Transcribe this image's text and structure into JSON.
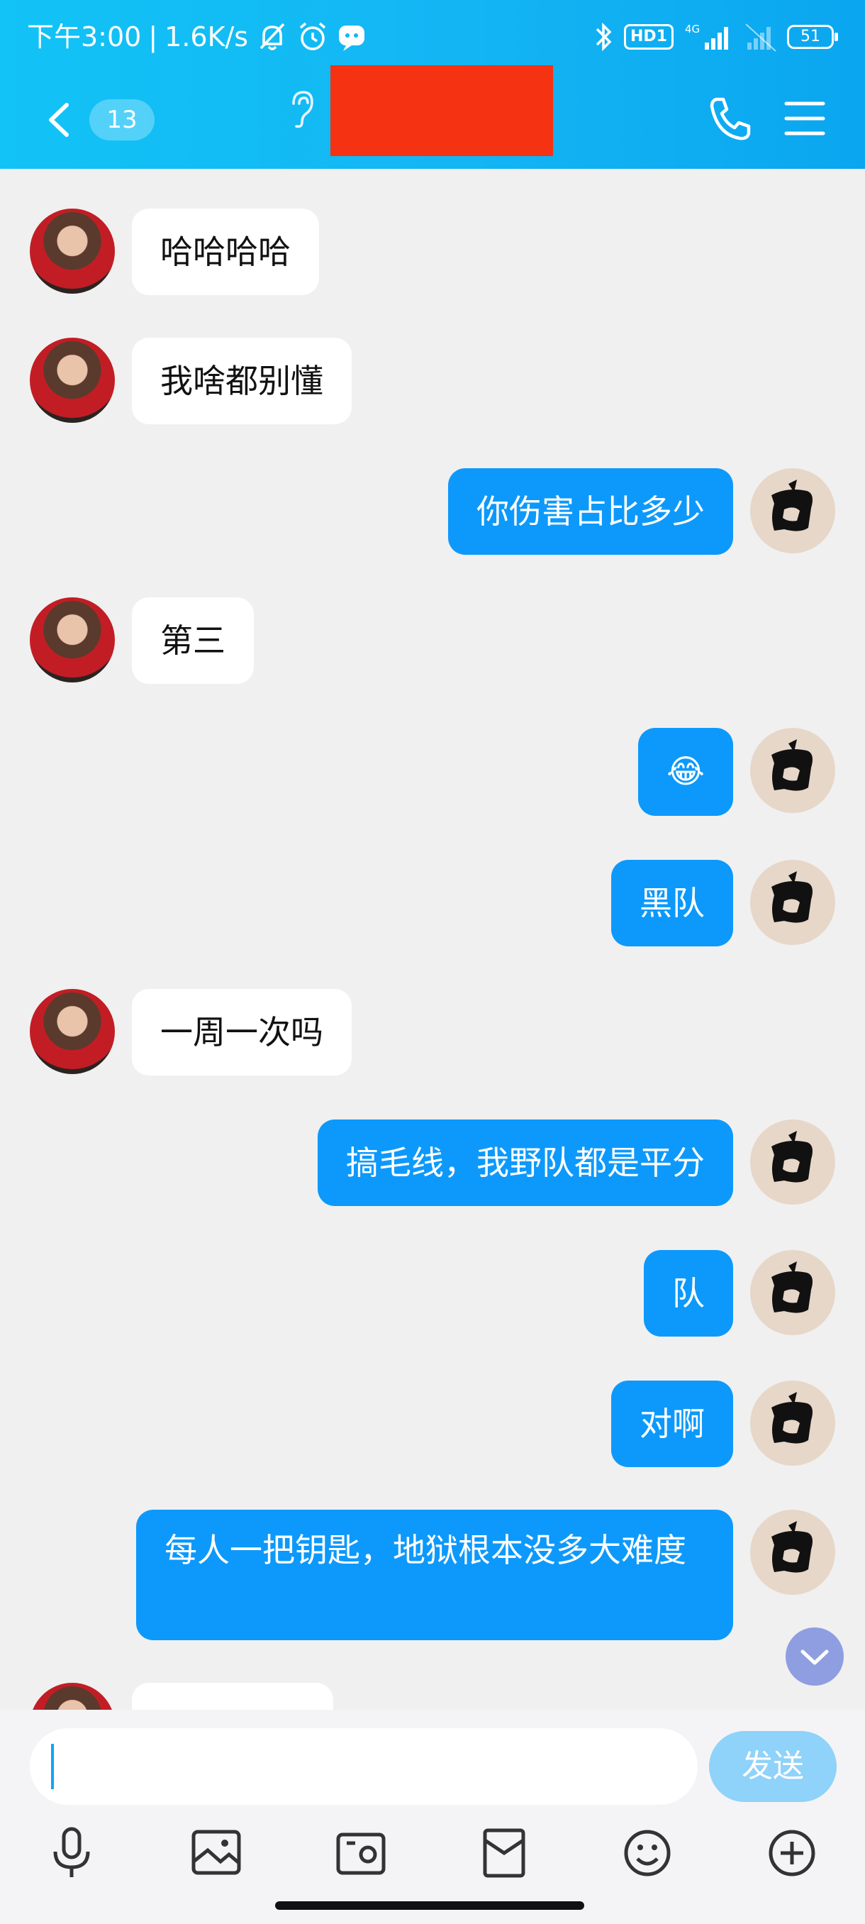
{
  "status_bar": {
    "time": "下午3:00",
    "separator": "|",
    "net_speed": "1.6K/s",
    "hd_label": "HD1",
    "network": "4G",
    "battery": "51"
  },
  "header": {
    "unread_count": "13",
    "title": "",
    "colors": {
      "header_bg": "#13b5f3",
      "title_redaction": "#f53212"
    }
  },
  "messages": [
    {
      "side": "in",
      "text": "哈哈哈哈"
    },
    {
      "side": "in",
      "text": "我啥都别懂"
    },
    {
      "side": "out",
      "text": "你伤害占比多少"
    },
    {
      "side": "in",
      "text": "第三"
    },
    {
      "side": "out",
      "text": "😂"
    },
    {
      "side": "out",
      "text": "黑队"
    },
    {
      "side": "in",
      "text": "一周一次吗"
    },
    {
      "side": "out",
      "text": "搞毛线，我野队都是平分"
    },
    {
      "side": "out",
      "text": "队"
    },
    {
      "side": "out",
      "text": "对啊"
    },
    {
      "side": "out",
      "text": "每人一把钥匙，地狱根本没多大难度"
    },
    {
      "side": "in",
      "text": ""
    }
  ],
  "input": {
    "value": "",
    "placeholder": "",
    "send_label": "发送"
  },
  "toolbar_icons": [
    "microphone-icon",
    "image-icon",
    "camera-icon",
    "red-packet-icon",
    "emoji-icon",
    "plus-icon"
  ],
  "colors": {
    "outgoing_bubble": "#0d99fb",
    "incoming_bubble": "#ffffff",
    "chat_bg": "#f0f0f0"
  }
}
